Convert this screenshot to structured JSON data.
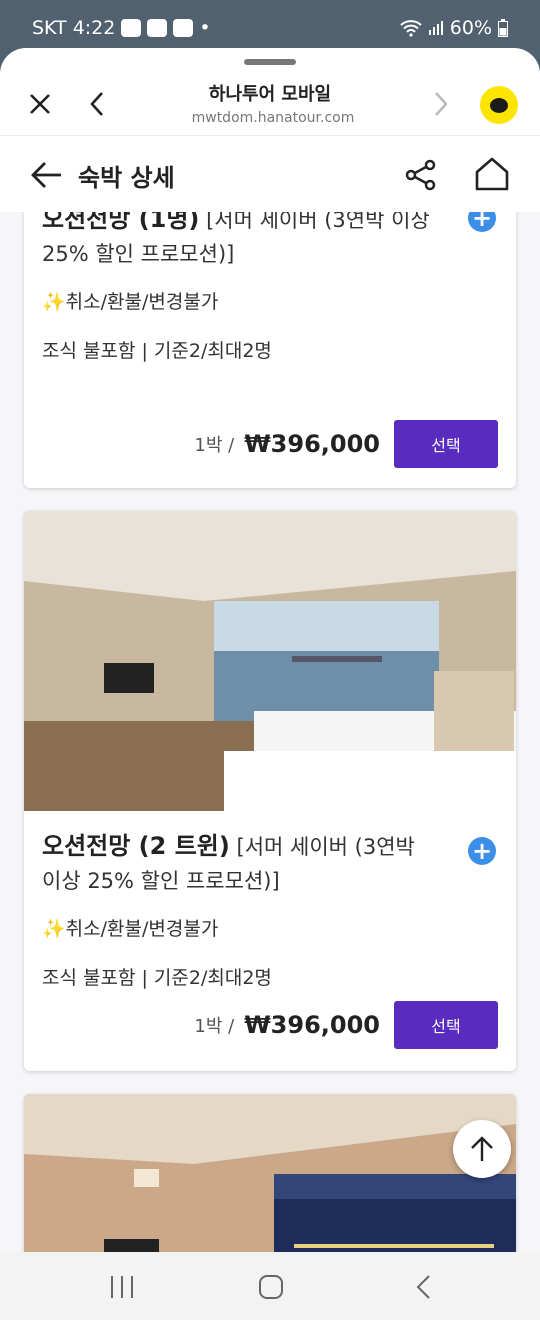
{
  "status_bar": {
    "carrier_time": "SKT 4:22",
    "dot": "•",
    "battery": "60%"
  },
  "browser": {
    "title": "하나투어 모바일",
    "url": "mwtdom.hanatour.com"
  },
  "header": {
    "title": "숙박 상세"
  },
  "rooms": [
    {
      "name_bold": "오션전망 (1명)",
      "name_rest": "[서머 세이버 (3연박 이상 25% 할인 프로모션)]",
      "cancel_policy": "✨취소/환불/변경불가",
      "meal_info": "조식 불포함 | 기준2/최대2명",
      "per_night": "1박 /",
      "price": "₩396,000",
      "select_label": "선택"
    },
    {
      "name_bold": "오션전망 (2 트윈)",
      "name_rest": "[서머 세이버 (3연박 이상 25% 할인 프로모션)]",
      "cancel_policy": "✨취소/환불/변경불가",
      "meal_info": "조식 불포함 | 기준2/최대2명",
      "per_night": "1박 /",
      "price": "₩396,000",
      "select_label": "선택"
    }
  ],
  "icons": {
    "close": "close-icon",
    "back": "chevron-left-icon",
    "forward": "chevron-right-icon",
    "kakao": "kakao-chat-icon",
    "share": "share-icon",
    "home": "home-icon",
    "scroll_top": "arrow-up-icon",
    "add": "plus-icon"
  },
  "colors": {
    "accent": "#5a2bbf",
    "plus": "#3c8fe8",
    "kakao": "#fee500",
    "status_bar": "#51616f"
  }
}
